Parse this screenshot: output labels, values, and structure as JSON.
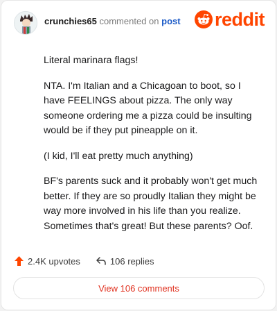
{
  "header": {
    "username": "crunchies65",
    "action_text": "commented on",
    "post_link": "post",
    "logo_text": "reddit"
  },
  "comment": {
    "paragraphs": [
      "Literal marinara flags!",
      "NTA. I'm Italian and a Chicagoan to boot, so I have FEELINGS about pizza. The only way someone ordering me a pizza could be insulting would be if they put pineapple on it.",
      "(I kid, I'll eat pretty much anything)",
      "BF's parents suck and it probably won't get much better. If they are so proudly Italian they might be way more involved in his life than you realize. Sometimes that's great! But these parents? Oof."
    ]
  },
  "footer": {
    "upvotes": "2.4K upvotes",
    "replies": "106 replies",
    "view_button": "View 106 comments"
  },
  "icons": {
    "upvote": "arrow-up-icon",
    "replies": "reply-arrow-icon",
    "logo": "reddit-snoo-icon"
  },
  "colors": {
    "brand": "#ff4500",
    "link": "#1c5bc7",
    "button_text": "#e0301e"
  }
}
